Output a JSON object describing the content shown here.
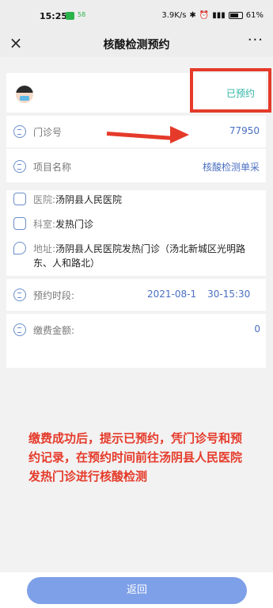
{
  "statusbar": {
    "time": "15:25",
    "extra": "58",
    "network": "3.9K/s",
    "battery": "61%"
  },
  "nav": {
    "close": "×",
    "title": "核酸检测预约",
    "more": "···"
  },
  "booking": {
    "status": "已预约",
    "clinic_no_label": "门诊号",
    "clinic_no": "77950",
    "item_label": "项目名称",
    "item_value": "核酸检测单采",
    "hospital_label": "医院:",
    "hospital": "汤阴县人民医院",
    "dept_label": "科室:",
    "dept": "发热门诊",
    "address_label": "地址:",
    "address": "汤阴县人民医院发热门诊（汤北新城区光明路东、人和路北）",
    "time_label": "预约时段:",
    "time_left": "2021-08-1",
    "time_right": "30-15:30",
    "fee_label": "缴费金额:",
    "fee": "0"
  },
  "annotation": {
    "note": "缴费成功后，提示已预约，凭门诊号和预约记录，在预约时间前往汤阴县人民医院发热门诊进行核酸检测"
  },
  "footer": {
    "back_label": "返回"
  },
  "colors": {
    "accent": "#7ea0e8",
    "status": "#2fb6a4",
    "annotation": "#e53a2a"
  }
}
